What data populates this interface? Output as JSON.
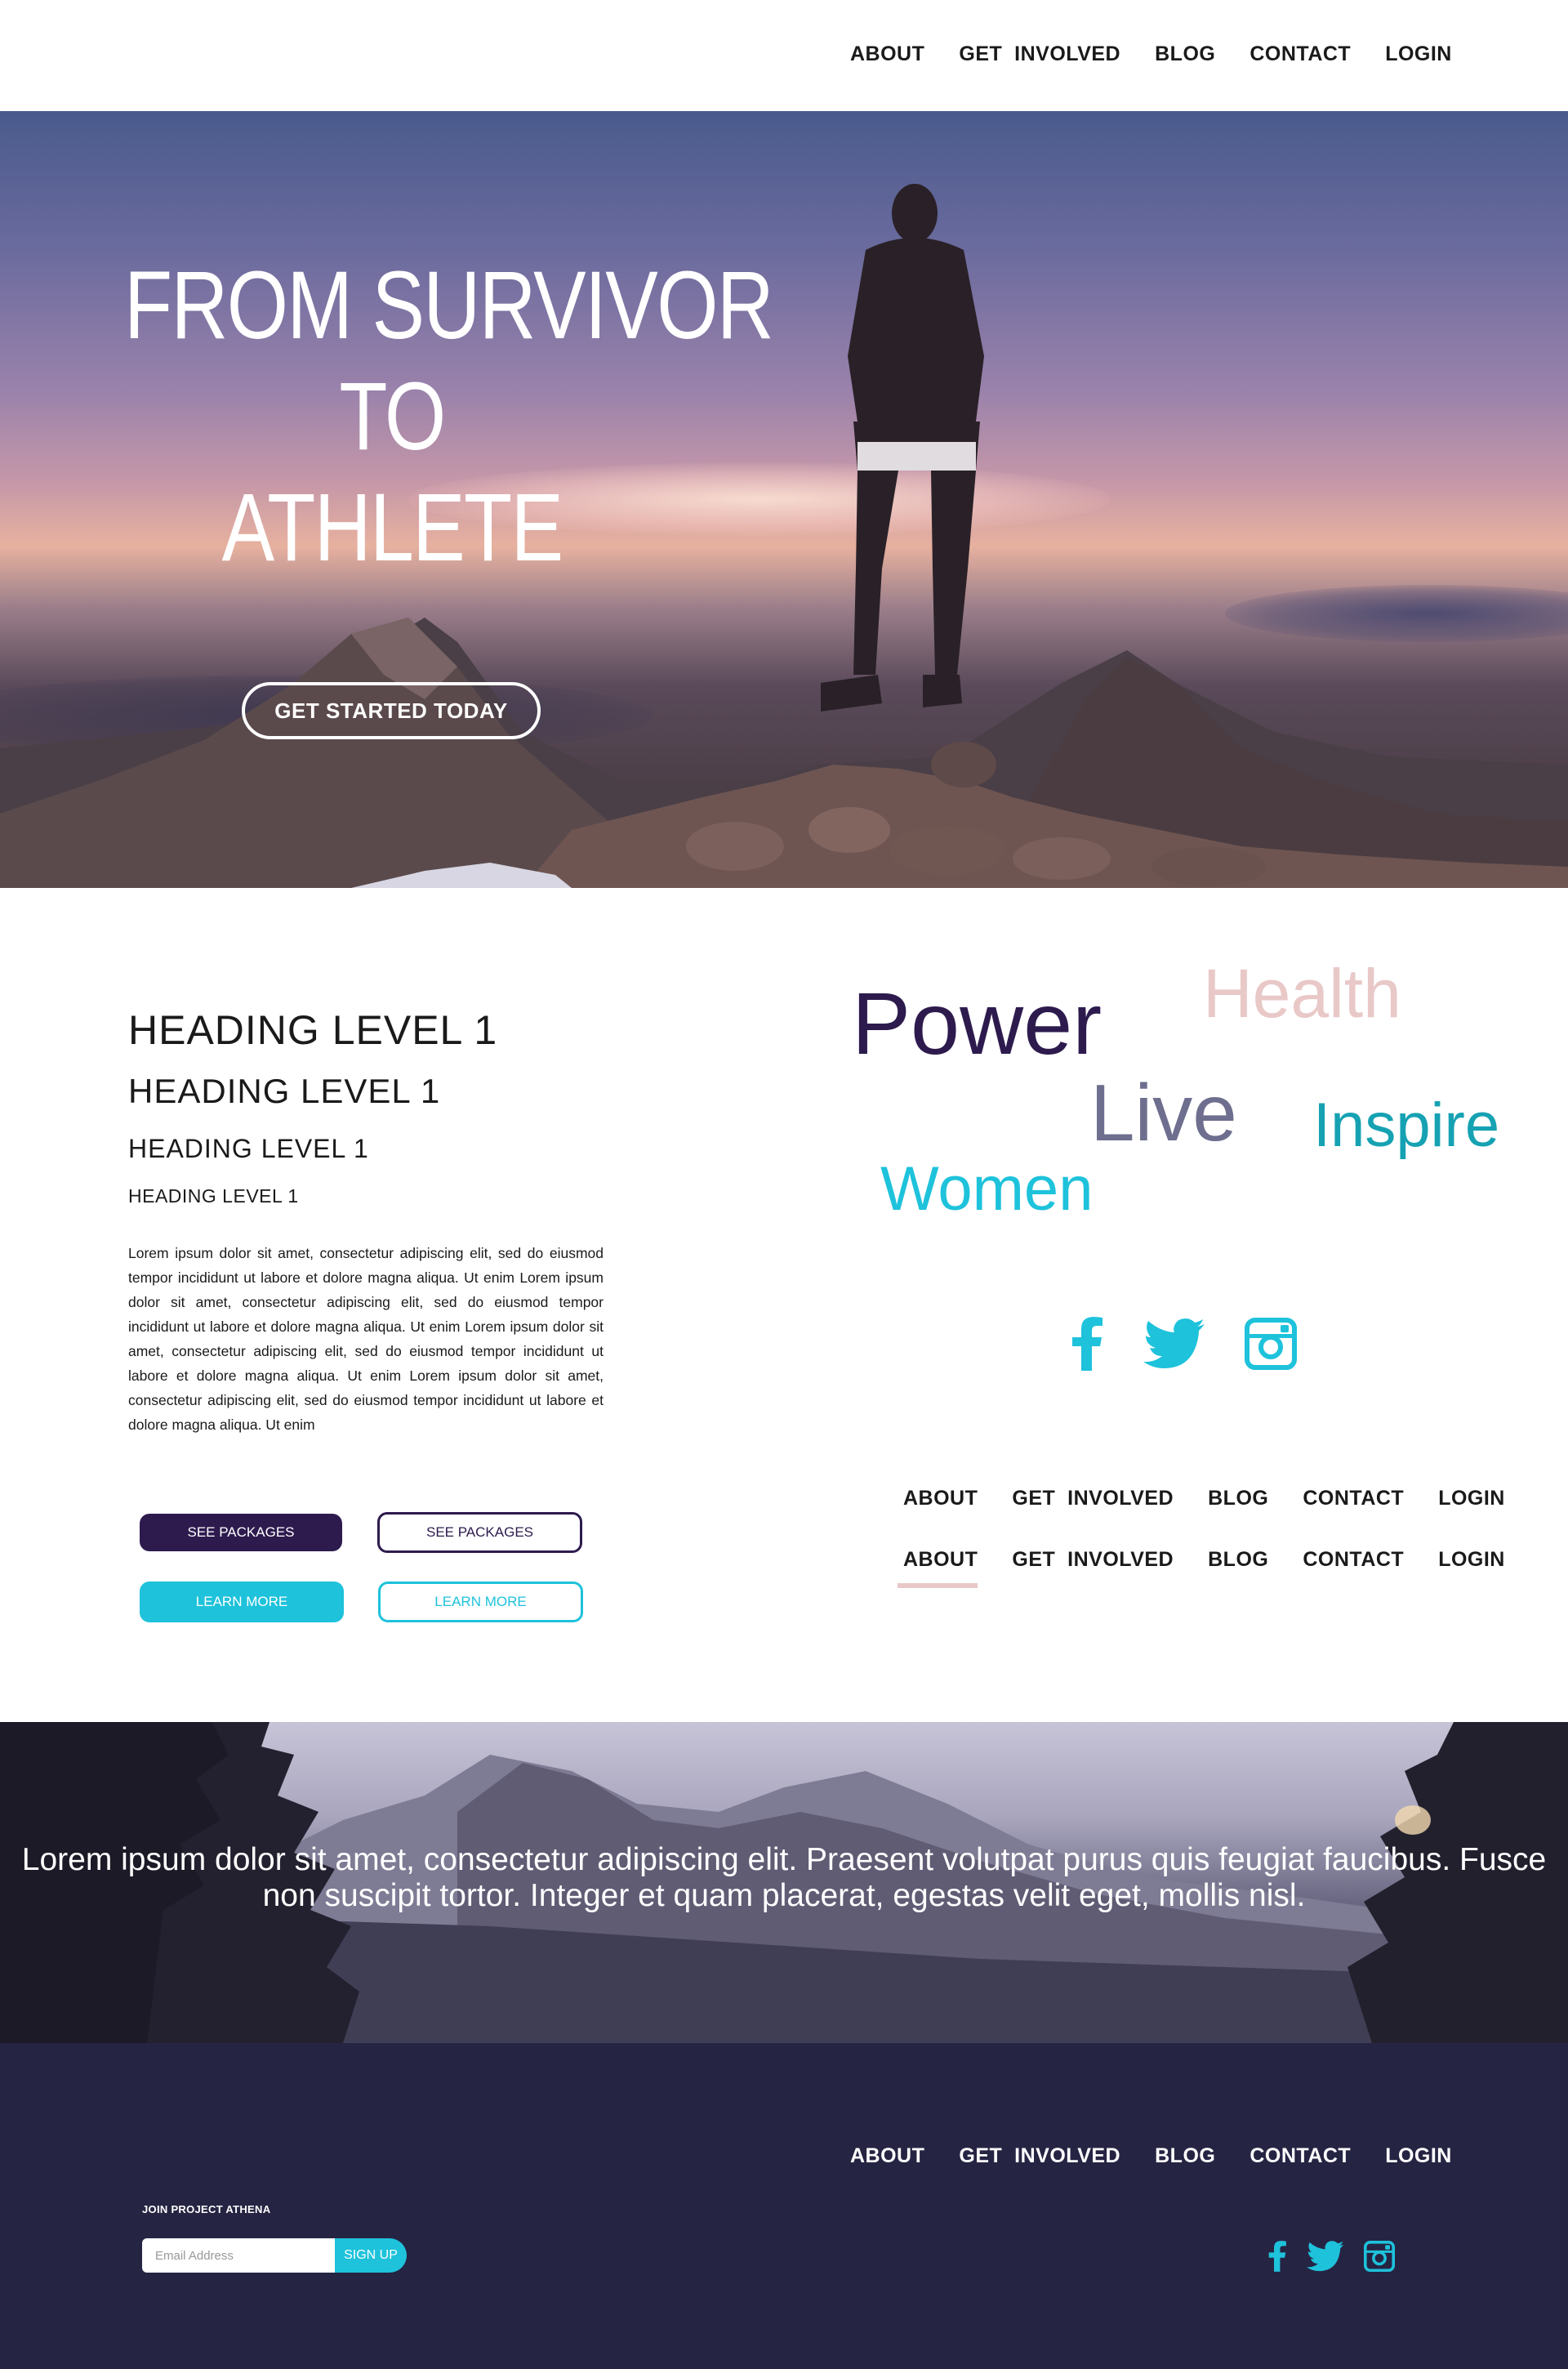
{
  "nav": {
    "items": [
      {
        "label": "ABOUT"
      },
      {
        "label": "GET  INVOLVED"
      },
      {
        "label": "BLOG"
      },
      {
        "label": "CONTACT"
      },
      {
        "label": "LOGIN"
      }
    ]
  },
  "hero": {
    "title_lines": [
      "FROM SURVIVOR",
      "TO",
      "ATHLETE"
    ],
    "cta_label": "GET STARTED TODAY"
  },
  "style_guide": {
    "headings": [
      "HEADING LEVEL 1",
      "HEADING LEVEL 1",
      "HEADING LEVEL 1",
      "HEADING LEVEL 1"
    ],
    "body_text": "Lorem ipsum dolor sit amet, consectetur adipiscing elit, sed do eiusmod tempor incididunt ut labore et dolore magna aliqua. Ut enim Lorem ipsum dolor sit amet, consectetur adipiscing elit, sed do eiusmod tempor incididunt ut labore et dolore magna aliqua. Ut enim Lorem ipsum dolor sit amet, consectetur adipiscing elit, sed do eiusmod tempor incididunt ut labore et dolore magna aliqua. Ut enim Lorem ipsum dolor sit amet, consectetur adipiscing elit, sed do eiusmod tempor incididunt ut labore et dolore magna aliqua. Ut enim",
    "buttons": {
      "packages_solid": "SEE PACKAGES",
      "packages_outline": "SEE PACKAGES",
      "learn_solid": "LEARN MORE",
      "learn_outline": "LEARN MORE"
    }
  },
  "word_cloud": {
    "power": "Power",
    "health": "Health",
    "live": "Live",
    "inspire": "Inspire",
    "women": "Women"
  },
  "nav_styles": {
    "active_item": "ABOUT"
  },
  "social": {
    "icons": [
      "facebook-icon",
      "twitter-icon",
      "instagram-icon"
    ]
  },
  "banner": {
    "quote": "Lorem ipsum dolor sit amet, consectetur adipiscing elit. Praesent volutpat purus quis feugiat faucibus. Fusce non suscipit tortor. Integer et quam placerat, egestas velit eget, mollis nisl."
  },
  "footer": {
    "join_label": "JOIN PROJECT ATHENA",
    "email_placeholder": "Email Address",
    "signup_label": "SIGN UP"
  },
  "colors": {
    "primary_dark": "#2d1b4e",
    "accent_cyan": "#1ec2db",
    "accent_pink": "#e9c8c8",
    "footer_bg": "#262443",
    "teal": "#16a2b3",
    "slate": "#6e6e8f"
  }
}
